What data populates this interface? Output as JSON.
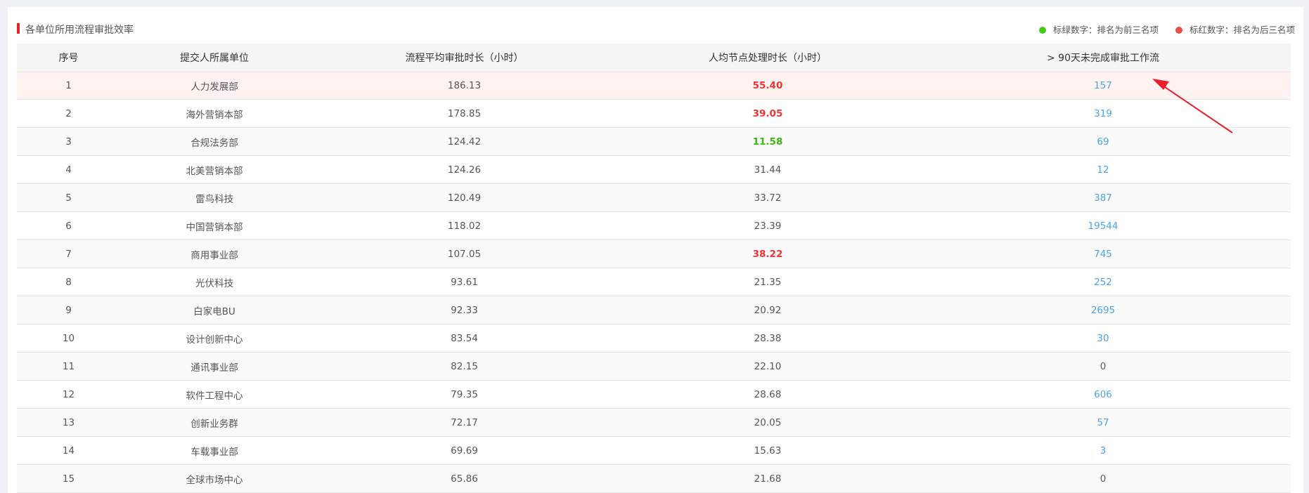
{
  "title": "各单位所用流程审批效率",
  "legend": {
    "green": "标绿数字：排名为前三名项",
    "red": "标红数字：排名为后三名项"
  },
  "colors": {
    "red": "#ec3535",
    "green": "#3cb80f",
    "link": "#4aa4e6",
    "accent": "#e8202a"
  },
  "columns": [
    "序号",
    "提交人所属单位",
    "流程平均审批时长（小时）",
    "人均节点处理时长（小时）",
    "> 90天未完成审批工作流"
  ],
  "rows": [
    {
      "no": "1",
      "unit": "人力发展部",
      "avg": "186.13",
      "per": "55.40",
      "per_style": "red",
      "pending": "157"
    },
    {
      "no": "2",
      "unit": "海外营销本部",
      "avg": "178.85",
      "per": "39.05",
      "per_style": "red",
      "pending": "319"
    },
    {
      "no": "3",
      "unit": "合规法务部",
      "avg": "124.42",
      "per": "11.58",
      "per_style": "green",
      "pending": "69"
    },
    {
      "no": "4",
      "unit": "北美营销本部",
      "avg": "124.26",
      "per": "31.44",
      "per_style": "normal",
      "pending": "12"
    },
    {
      "no": "5",
      "unit": "雷鸟科技",
      "avg": "120.49",
      "per": "33.72",
      "per_style": "normal",
      "pending": "387"
    },
    {
      "no": "6",
      "unit": "中国营销本部",
      "avg": "118.02",
      "per": "23.39",
      "per_style": "normal",
      "pending": "19544"
    },
    {
      "no": "7",
      "unit": "商用事业部",
      "avg": "107.05",
      "per": "38.22",
      "per_style": "red",
      "pending": "745"
    },
    {
      "no": "8",
      "unit": "光伏科技",
      "avg": "93.61",
      "per": "21.35",
      "per_style": "normal",
      "pending": "252"
    },
    {
      "no": "9",
      "unit": "白家电BU",
      "avg": "92.33",
      "per": "20.92",
      "per_style": "normal",
      "pending": "2695"
    },
    {
      "no": "10",
      "unit": "设计创新中心",
      "avg": "83.54",
      "per": "28.38",
      "per_style": "normal",
      "pending": "30"
    },
    {
      "no": "11",
      "unit": "通讯事业部",
      "avg": "82.15",
      "per": "22.10",
      "per_style": "normal",
      "pending": "0"
    },
    {
      "no": "12",
      "unit": "软件工程中心",
      "avg": "79.35",
      "per": "28.68",
      "per_style": "normal",
      "pending": "606"
    },
    {
      "no": "13",
      "unit": "创新业务群",
      "avg": "72.17",
      "per": "20.05",
      "per_style": "normal",
      "pending": "57"
    },
    {
      "no": "14",
      "unit": "车载事业部",
      "avg": "69.69",
      "per": "15.63",
      "per_style": "normal",
      "pending": "3"
    },
    {
      "no": "15",
      "unit": "全球市场中心",
      "avg": "65.86",
      "per": "21.68",
      "per_style": "normal",
      "pending": "0"
    }
  ],
  "highlighted_row": 1,
  "annotation": {
    "icon": "red-arrow-icon",
    "target_row": 1
  }
}
